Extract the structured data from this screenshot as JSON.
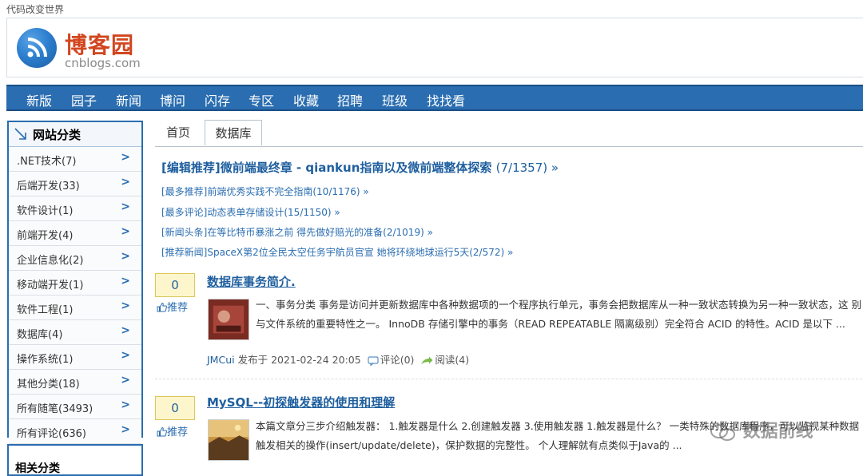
{
  "slogan": "代码改变世界",
  "logo": {
    "name_cn": "博客园",
    "domain": "cnblogs.com"
  },
  "nav": [
    "新版",
    "园子",
    "新闻",
    "博问",
    "闪存",
    "专区",
    "收藏",
    "招聘",
    "班级",
    "找找看"
  ],
  "sidebar": {
    "title": "网站分类",
    "items": [
      {
        "label": ".NET技术(7)"
      },
      {
        "label": "后端开发(33)"
      },
      {
        "label": "软件设计(1)"
      },
      {
        "label": "前端开发(4)"
      },
      {
        "label": "企业信息化(2)"
      },
      {
        "label": "移动端开发(1)"
      },
      {
        "label": "软件工程(1)"
      },
      {
        "label": "数据库(4)"
      },
      {
        "label": "操作系统(1)"
      },
      {
        "label": "其他分类(18)"
      },
      {
        "label": "所有随笔(3493)"
      },
      {
        "label": "所有评论(636)"
      }
    ],
    "arrow": ">",
    "bottom_title": "相关分类"
  },
  "tabs": [
    "首页",
    "数据库"
  ],
  "recommend": {
    "main": {
      "text": "[编辑推荐]微前端最终章 - qiankun指南以及微前端整体探索",
      "count": "(7/1357) »"
    },
    "items": [
      "[最多推荐]前端优秀实践不完全指南(10/1176) »",
      "[最多评论]动态表单存储设计(15/1150) »",
      "[新闻头条]在等比特币暴涨之前 得先做好赔光的准备(2/1019) »",
      "[推荐新闻]SpaceX第2位全民太空任务宇航员官宣 她将环绕地球运行5天(2/572) »"
    ]
  },
  "posts": [
    {
      "digg_count": "0",
      "digg_label": "推荐",
      "title": "数据库事务简介.",
      "summary": "一、事务分类 事务是访问并更新数据库中各种数据项的一个程序执行单元，事务会把数据库从一种一致状态转换为另一种一致状态，这 别与文件系统的重要特性之一。 InnoDB 存储引擎中的事务（READ REPEATABLE 隔离级别）完全符合 ACID 的特性。ACID 是以下 ...",
      "author": "JMCui",
      "posted": "发布于 2021-02-24 20:05",
      "comments": "评论(0)",
      "views": "阅读(4)"
    },
    {
      "digg_count": "0",
      "digg_label": "推荐",
      "title": "MySQL--初探触发器的使用和理解",
      "summary": "本篇文章分三步介绍触发器： 1.触发器是什么 2.创建触发器 3.使用触发器 1.触发器是什么？ 一类特殊的数据库程序，可以监视某种数据 触发相关的操作(insert/update/delete)，保护数据的完整性。 个人理解就有点类似于Java的 ..."
    }
  ],
  "watermark": "数据前线",
  "colors": {
    "nav_bg": "#2a6db0",
    "link": "#1f5f9f",
    "logo_red": "#d2461f"
  }
}
